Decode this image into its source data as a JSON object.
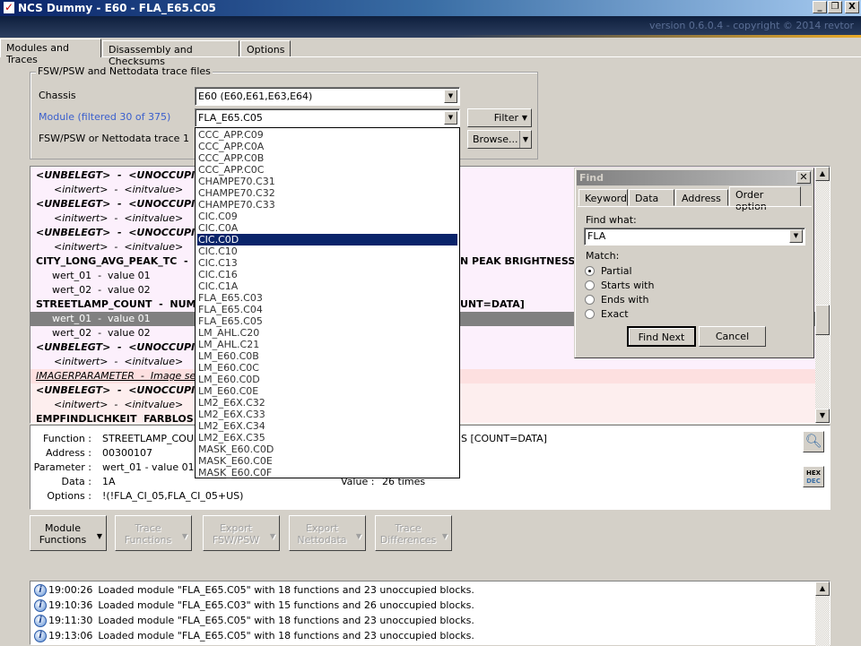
{
  "window": {
    "title": "NCS Dummy - E60 - FLA_E65.C05",
    "version": "version 0.6.0.4 - copyright © 2014 revtor",
    "minimize": "_",
    "restore": "❐",
    "close": "X"
  },
  "tabs": [
    {
      "label": "Modules and Traces",
      "active": true
    },
    {
      "label": "Disassembly and Checksums"
    },
    {
      "label": "Options"
    }
  ],
  "trace_group": {
    "title": "FSW/PSW and Nettodata trace files",
    "chassis_label": "Chassis",
    "chassis_value": "E60  (E60,E61,E63,E64)",
    "module_label": "Module (filtered 30 of 375)",
    "module_value": "FLA_E65.C05",
    "trace_label": "FSW/PSW or Nettodata trace 1",
    "filter_button": "Filter",
    "browse_button": "Browse..."
  },
  "module_dropdown": {
    "selected": "CIC.C0D",
    "items": [
      "CCC_APP.C09",
      "CCC_APP.C0A",
      "CCC_APP.C0B",
      "CCC_APP.C0C",
      "CHAMPE70.C31",
      "CHAMPE70.C32",
      "CHAMPE70.C33",
      "CIC.C09",
      "CIC.C0A",
      "CIC.C0D",
      "CIC.C10",
      "CIC.C13",
      "CIC.C16",
      "CIC.C1A",
      "FLA_E65.C03",
      "FLA_E65.C04",
      "FLA_E65.C05",
      "LM_AHL.C20",
      "LM_AHL.C21",
      "LM_E60.C0B",
      "LM_E60.C0C",
      "LM_E60.C0D",
      "LM_E60.C0E",
      "LM2_E6X.C32",
      "LM2_E6X.C33",
      "LM2_E6X.C34",
      "LM2_E6X.C35",
      "MASK_E60.C0D",
      "MASK_E60.C0E",
      "MASK_E60.C0F"
    ]
  },
  "tree": [
    {
      "kind": "unocc",
      "text": "<UNBELEGT>  -  <UNOCCUPIED>"
    },
    {
      "kind": "init",
      "text": "<initwert>  -  <initvalue>"
    },
    {
      "kind": "unocc",
      "text": "<UNBELEGT>  -  <UNOCCUPIED>"
    },
    {
      "kind": "init",
      "text": "<initwert>  -  <initvalue>"
    },
    {
      "kind": "unocc",
      "text": "<UNBELEGT>  -  <UNOCCUPIED>"
    },
    {
      "kind": "init",
      "text": "<initwert>  -  <initvalue>"
    },
    {
      "kind": "func",
      "text": "CITY_LONG_AVG_PEAK_TC  -  LO",
      "tail": "N PEAK BRIGHTNESS"
    },
    {
      "kind": "param",
      "text": "wert_01  -  value 01"
    },
    {
      "kind": "param",
      "text": "wert_02  -  value 02"
    },
    {
      "kind": "func",
      "text": "STREETLAMP_COUNT  -  NUMBER",
      "tail": "UNT=DATA]"
    },
    {
      "kind": "sel",
      "text": "wert_01  -  value 01"
    },
    {
      "kind": "param",
      "text": "wert_02  -  value 02"
    },
    {
      "kind": "unocc",
      "text": "<UNBELEGT>  -  <UNOCCUPIED>"
    },
    {
      "kind": "init",
      "text": "<initwert>  -  <initvalue>"
    },
    {
      "kind": "header",
      "text": "IMAGERPARAMETER  -  Image senso"
    },
    {
      "kind": "unocc2",
      "text": "<UNBELEGT>  -  <UNOCCUPIED>"
    },
    {
      "kind": "init2",
      "text": "<initwert>  -  <initvalue>"
    },
    {
      "kind": "func2",
      "text": "EMPFINDLICHKEIT  FARBLOS  -  S"
    }
  ],
  "find": {
    "title": "Find",
    "tabs": [
      "Keyword",
      "Data",
      "Address",
      "Order option"
    ],
    "active_tab": "Order option",
    "find_what_label": "Find what:",
    "find_what_value": "FLA",
    "match_label": "Match:",
    "options": [
      "Partial",
      "Starts with",
      "Ends with",
      "Exact"
    ],
    "selected_option": "Partial",
    "find_next": "Find Next",
    "cancel": "Cancel"
  },
  "details": {
    "function_label": "Function :",
    "function_value": "STREETLAMP_COUNT",
    "function_tail": "S [COUNT=DATA]",
    "address_label": "Address :",
    "address_value": "00300107",
    "parameter_label": "Parameter :",
    "parameter_value": "wert_01  -  value 01",
    "data_label": "Data :",
    "data_value": "1A",
    "options_label": "Options :",
    "options_value": "!(!FLA_CI_05,FLA_CI_05+US)",
    "value_label": "Value :",
    "value_value": "26 times",
    "hex": "HEX",
    "dec": "DEC"
  },
  "actions": [
    {
      "label1": "Module",
      "label2": "Functions",
      "enabled": true
    },
    {
      "label1": "Trace",
      "label2": "Functions",
      "enabled": false
    },
    {
      "label1": "Export",
      "label2": "FSW/PSW",
      "enabled": false
    },
    {
      "label1": "Export",
      "label2": "Nettodata",
      "enabled": false
    },
    {
      "label1": "Trace",
      "label2": "Differences",
      "enabled": false
    }
  ],
  "log": [
    {
      "time": "19:00:26",
      "message": "Loaded module \"FLA_E65.C05\" with 18 functions and 23 unoccupied blocks."
    },
    {
      "time": "19:10:36",
      "message": "Loaded module \"FLA_E65.C03\" with 15 functions and 26 unoccupied blocks."
    },
    {
      "time": "19:11:30",
      "message": "Loaded module \"FLA_E65.C05\" with 18 functions and 23 unoccupied blocks."
    },
    {
      "time": "19:13:06",
      "message": "Loaded module \"FLA_E65.C05\" with 18 functions and 23 unoccupied blocks."
    }
  ],
  "colors": {
    "module_label": "#3a5fcd",
    "selection": "#0a246a",
    "tree_bg": "#fcf0fc",
    "tree_header_bg": "#fde0e0",
    "tree_selected": "#808080"
  }
}
